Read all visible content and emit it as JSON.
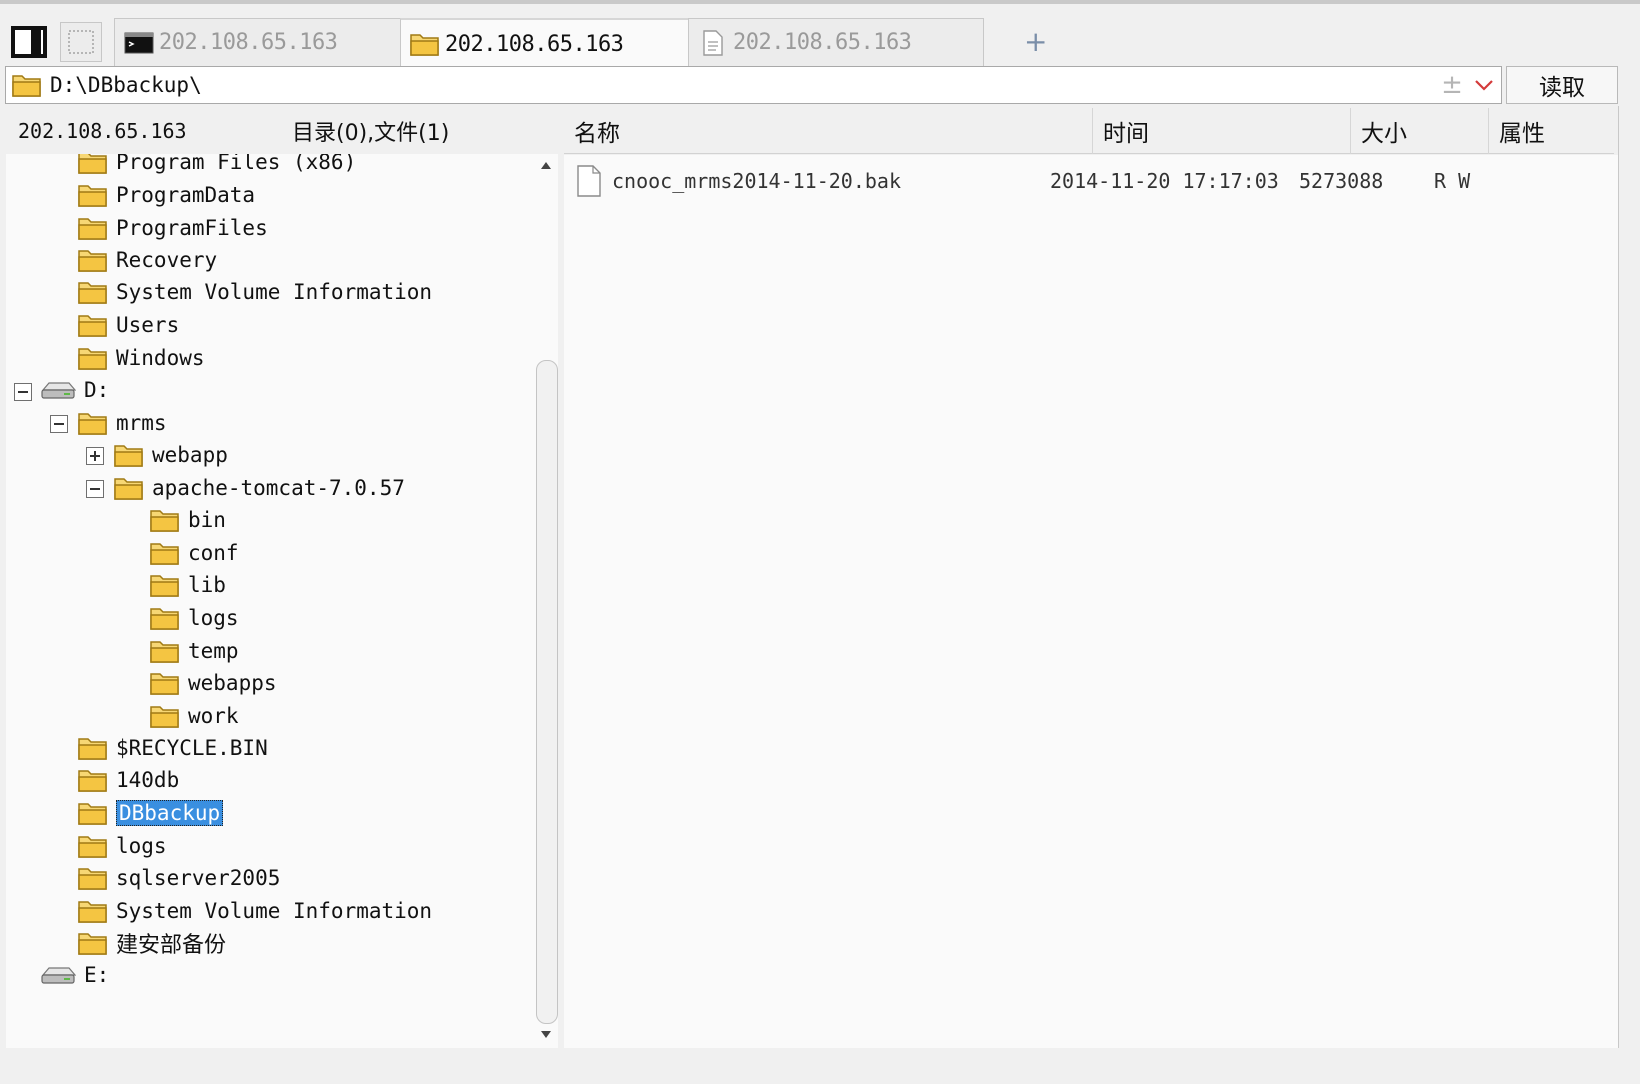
{
  "tabs": [
    {
      "label": "202.108.65.163",
      "kind": "terminal",
      "active": false
    },
    {
      "label": "202.108.65.163",
      "kind": "folder",
      "active": true
    },
    {
      "label": "202.108.65.163",
      "kind": "document",
      "active": false
    }
  ],
  "add_tab_label": "+",
  "address": {
    "path": "D:\\DBbackup\\",
    "plus_label": "±"
  },
  "read_button": "读取",
  "info": {
    "host": "202.108.65.163",
    "counts": "目录(0),文件(1)"
  },
  "tree": [
    {
      "label": "Program Files (x86)"
    },
    {
      "label": "ProgramData"
    },
    {
      "label": "ProgramFiles"
    },
    {
      "label": "Recovery"
    },
    {
      "label": "System Volume Information"
    },
    {
      "label": "Users"
    },
    {
      "label": "Windows"
    },
    {
      "label": "D:"
    },
    {
      "label": "mrms"
    },
    {
      "label": "webapp"
    },
    {
      "label": "apache-tomcat-7.0.57"
    },
    {
      "label": "bin"
    },
    {
      "label": "conf"
    },
    {
      "label": "lib"
    },
    {
      "label": "logs"
    },
    {
      "label": "temp"
    },
    {
      "label": "webapps"
    },
    {
      "label": "work"
    },
    {
      "label": "$RECYCLE.BIN"
    },
    {
      "label": "140db"
    },
    {
      "label": "DBbackup"
    },
    {
      "label": "logs"
    },
    {
      "label": "sqlserver2005"
    },
    {
      "label": "System Volume Information"
    },
    {
      "label": "建安部备份"
    },
    {
      "label": "E:"
    }
  ],
  "columns": {
    "name": "名称",
    "time": "时间",
    "size": "大小",
    "attr": "属性"
  },
  "files": [
    {
      "name": "cnooc_mrms2014-11-20.bak",
      "time": "2014-11-20 17:17:03",
      "size": "5273088",
      "attr": "R W"
    }
  ],
  "colors": {
    "folder": "#f4c542",
    "selection": "#3a8fe0",
    "tab_plus": "#7a8ea8"
  }
}
